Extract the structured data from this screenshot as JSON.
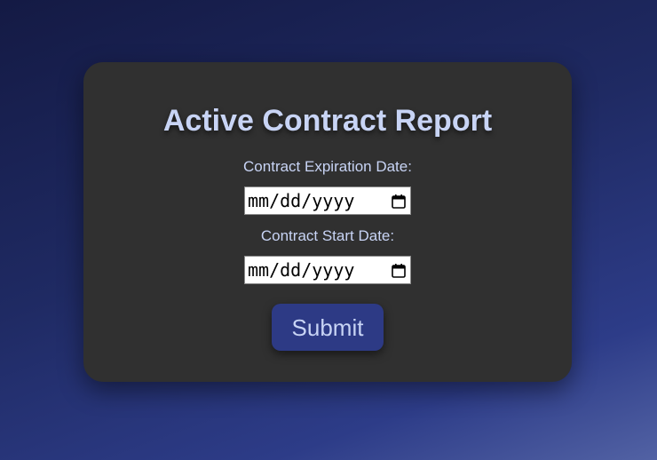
{
  "page": {
    "title": "Active Contract Report"
  },
  "form": {
    "expiration_label": "Contract Expiration Date:",
    "expiration_placeholder": "mm/dd/yyyy",
    "start_label": "Contract Start Date:",
    "start_placeholder": "mm/dd/yyyy",
    "submit_label": "Submit"
  },
  "icons": {
    "date_picker": "calendar-icon"
  },
  "colors": {
    "card_background": "#303030",
    "text": "#c8d4f5",
    "button": "#2d3a85",
    "background_top": "#141a44",
    "background_bottom": "#5262a4"
  }
}
